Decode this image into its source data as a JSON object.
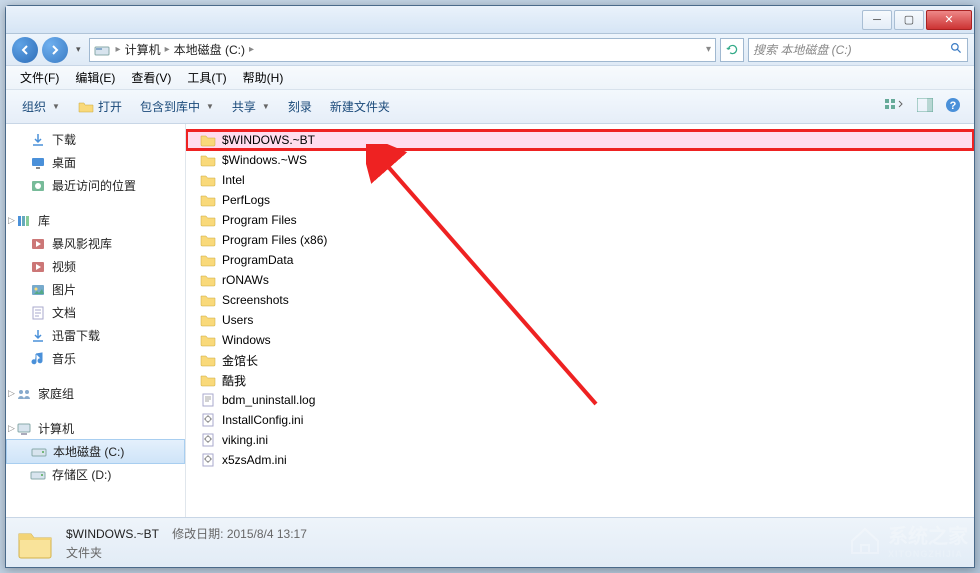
{
  "titlebar": {},
  "nav": {
    "breadcrumb": [
      "计算机",
      "本地磁盘 (C:)"
    ],
    "search_placeholder": "搜索 本地磁盘 (C:)"
  },
  "menubar": {
    "items": [
      "文件(F)",
      "编辑(E)",
      "查看(V)",
      "工具(T)",
      "帮助(H)"
    ]
  },
  "toolbar": {
    "organize": "组织",
    "open": "打开",
    "include": "包含到库中",
    "share": "共享",
    "burn": "刻录",
    "newfolder": "新建文件夹"
  },
  "sidebar": {
    "groups": [
      {
        "items": [
          {
            "label": "下载",
            "icon": "download",
            "indent": 1
          },
          {
            "label": "桌面",
            "icon": "desktop",
            "indent": 1
          },
          {
            "label": "最近访问的位置",
            "icon": "recent",
            "indent": 1
          }
        ]
      },
      {
        "head": {
          "label": "库",
          "icon": "library"
        },
        "items": [
          {
            "label": "暴风影视库",
            "icon": "video",
            "indent": 1
          },
          {
            "label": "视频",
            "icon": "video",
            "indent": 1
          },
          {
            "label": "图片",
            "icon": "pictures",
            "indent": 1
          },
          {
            "label": "文档",
            "icon": "documents",
            "indent": 1
          },
          {
            "label": "迅雷下载",
            "icon": "download",
            "indent": 1
          },
          {
            "label": "音乐",
            "icon": "music",
            "indent": 1
          }
        ]
      },
      {
        "head": {
          "label": "家庭组",
          "icon": "homegroup"
        },
        "items": []
      },
      {
        "head": {
          "label": "计算机",
          "icon": "computer"
        },
        "items": [
          {
            "label": "本地磁盘 (C:)",
            "icon": "drive",
            "indent": 1,
            "selected": true
          },
          {
            "label": "存储区 (D:)",
            "icon": "drive",
            "indent": 1
          }
        ]
      }
    ]
  },
  "files": [
    {
      "name": "$WINDOWS.~BT",
      "icon": "folder",
      "highlight": true
    },
    {
      "name": "$Windows.~WS",
      "icon": "folder"
    },
    {
      "name": "Intel",
      "icon": "folder"
    },
    {
      "name": "PerfLogs",
      "icon": "folder"
    },
    {
      "name": "Program Files",
      "icon": "folder"
    },
    {
      "name": "Program Files (x86)",
      "icon": "folder"
    },
    {
      "name": "ProgramData",
      "icon": "folder"
    },
    {
      "name": "rONAWs",
      "icon": "folder"
    },
    {
      "name": "Screenshots",
      "icon": "folder"
    },
    {
      "name": "Users",
      "icon": "folder"
    },
    {
      "name": "Windows",
      "icon": "folder"
    },
    {
      "name": "金馆长",
      "icon": "folder"
    },
    {
      "name": "酷我",
      "icon": "folder"
    },
    {
      "name": "bdm_uninstall.log",
      "icon": "file-txt"
    },
    {
      "name": "InstallConfig.ini",
      "icon": "file-ini"
    },
    {
      "name": "viking.ini",
      "icon": "file-ini"
    },
    {
      "name": "x5zsAdm.ini",
      "icon": "file-ini"
    }
  ],
  "status": {
    "selected_name": "$WINDOWS.~BT",
    "mod_label": "修改日期:",
    "mod_value": "2015/8/4 13:17",
    "type": "文件夹"
  },
  "watermark": {
    "brand": "系统之家"
  }
}
